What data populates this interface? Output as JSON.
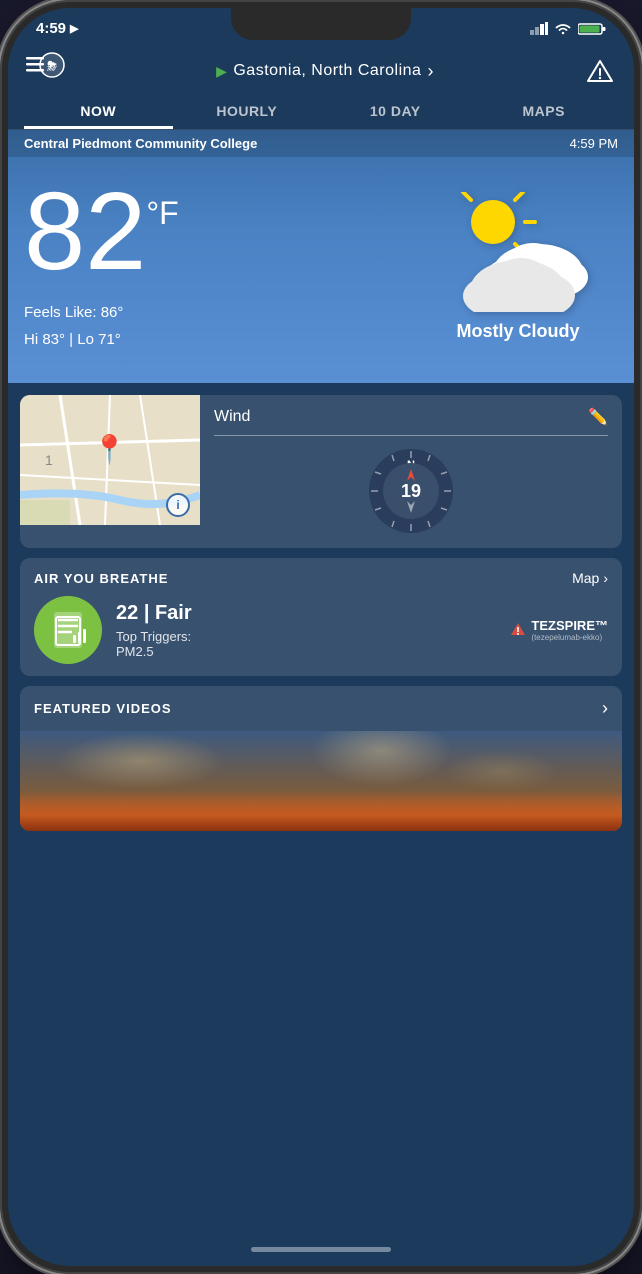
{
  "statusBar": {
    "time": "4:59",
    "locationIcon": "▶"
  },
  "header": {
    "location": "Gastonia,  North  Carolina",
    "locationArrow": "▸",
    "chevron": "›"
  },
  "navTabs": {
    "tabs": [
      {
        "id": "now",
        "label": "NOW",
        "active": true
      },
      {
        "id": "hourly",
        "label": "HOURLY",
        "active": false
      },
      {
        "id": "10day",
        "label": "10 DAY",
        "active": false
      },
      {
        "id": "maps",
        "label": "MAPS",
        "active": false
      }
    ]
  },
  "weatherStation": {
    "name": "Central Piedmont Community College",
    "time": "4:59 PM"
  },
  "currentWeather": {
    "temperature": "82",
    "unit": "°F",
    "feelsLike": "Feels Like: 86°",
    "hiLo": "Hi 83° | Lo 71°",
    "condition": "Mostly Cloudy"
  },
  "wind": {
    "label": "Wind",
    "speed": "19",
    "direction": "N"
  },
  "airQuality": {
    "sectionTitle": "AIR YOU BREATHE",
    "mapLink": "Map",
    "value": "22",
    "rating": "Fair",
    "triggersLabel": "Top Triggers:",
    "triggers": "PM2.5",
    "sponsorName": "TEZSPIRE™",
    "sponsorSubtext": "(tezepelumab-ekko)"
  },
  "featuredVideos": {
    "sectionTitle": "FEATURED VIDEOS"
  },
  "colors": {
    "skyBlue": "#4a82c4",
    "darkBlue": "#1c3a5c",
    "green": "#7dc143",
    "accent": "#3a6ea8"
  }
}
